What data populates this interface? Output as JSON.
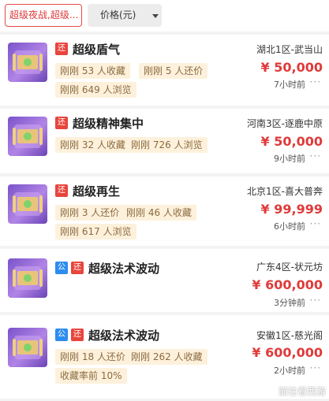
{
  "filter": {
    "search_text": "超级夜战,超级...",
    "sort_label": "价格(元)"
  },
  "items": [
    {
      "badges": [
        "还"
      ],
      "title": "超级盾气",
      "tags": [
        "刚刚 53 人收藏",
        "刚刚 5 人还价",
        "刚刚 649 人浏览"
      ],
      "server": "湖北1区-武当山",
      "price": "¥ 50,000",
      "time": "7小时前"
    },
    {
      "badges": [
        "还"
      ],
      "title": "超级精神集中",
      "tags": [
        "刚刚 32 人收藏",
        "刚刚 726 人浏览"
      ],
      "server": "河南3区-逐鹿中原",
      "price": "¥ 50,000",
      "time": "9小时前"
    },
    {
      "badges": [
        "还"
      ],
      "title": "超级再生",
      "tags": [
        "刚刚 3 人还价",
        "刚刚 46 人收藏",
        "刚刚 617 人浏览"
      ],
      "server": "北京1区-喜大普奔",
      "price": "¥ 99,999",
      "time": "6小时前"
    },
    {
      "badges": [
        "公",
        "还"
      ],
      "title": "超级法术波动",
      "tags": [],
      "server": "广东4区-状元坊",
      "price": "¥ 600,000",
      "time": "3分钟前"
    },
    {
      "badges": [
        "公",
        "还"
      ],
      "title": "超级法术波动",
      "tags": [
        "刚刚 18 人还价",
        "刚刚 262 人收藏",
        "收藏率前 10%"
      ],
      "server": "安徽1区-慈光阁",
      "price": "¥ 600,000",
      "time": "2小时前"
    }
  ],
  "more_label": "···",
  "watermark": "前往看西游",
  "colors": {
    "price": "#e03a3a",
    "badge_red": "#e8453c",
    "badge_blue": "#2d8cf0",
    "tag_bg": "#fdf1dc"
  }
}
